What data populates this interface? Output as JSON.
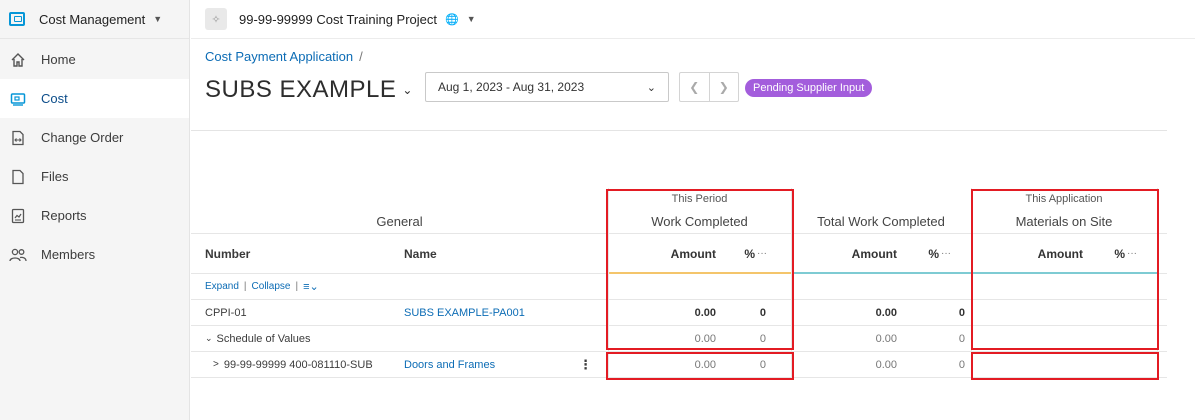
{
  "sidebar": {
    "module": "Cost Management",
    "items": [
      {
        "label": "Home",
        "icon": "home-icon"
      },
      {
        "label": "Cost",
        "icon": "cost-icon",
        "active": true
      },
      {
        "label": "Change Order",
        "icon": "change-order-icon"
      },
      {
        "label": "Files",
        "icon": "file-icon"
      },
      {
        "label": "Reports",
        "icon": "reports-icon"
      },
      {
        "label": "Members",
        "icon": "members-icon"
      }
    ]
  },
  "header": {
    "project": "99-99-99999 Cost Training Project"
  },
  "page": {
    "breadcrumb": "Cost Payment Application",
    "breadcrumb_sep": "/",
    "title": "SUBS EXAMPLE",
    "date_range": "Aug 1, 2023 - Aug 31, 2023",
    "status": "Pending Supplier Input",
    "status_color": "#a35ddc"
  },
  "table": {
    "groups": {
      "general": "General",
      "this_period": "This Period",
      "work_completed": "Work Completed",
      "total_work_completed": "Total Work Completed",
      "this_application": "This Application",
      "materials_on_site": "Materials on Site"
    },
    "columns": {
      "number": "Number",
      "name": "Name",
      "amount": "Amount",
      "percent": "%",
      "more": "···"
    },
    "toolbar": {
      "expand": "Expand",
      "sep1": "|",
      "collapse": "Collapse",
      "sep2": "|"
    },
    "rows": [
      {
        "number": "CPPI-01",
        "name": "SUBS EXAMPLE-PA001",
        "wc_amount": "0.00",
        "wc_pct": "0",
        "twc_amount": "0.00",
        "twc_pct": "0"
      },
      {
        "number": "Schedule of Values",
        "name": "",
        "wc_amount": "0.00",
        "wc_pct": "0",
        "twc_amount": "0.00",
        "twc_pct": "0"
      },
      {
        "number": "99-99-99999 400-081110-SUB",
        "name": "Doors and Frames",
        "wc_amount": "0.00",
        "wc_pct": "0",
        "twc_amount": "0.00",
        "twc_pct": "0"
      }
    ]
  },
  "colors": {
    "accent": "#0c6cb5",
    "highlight": "#e31b23"
  }
}
